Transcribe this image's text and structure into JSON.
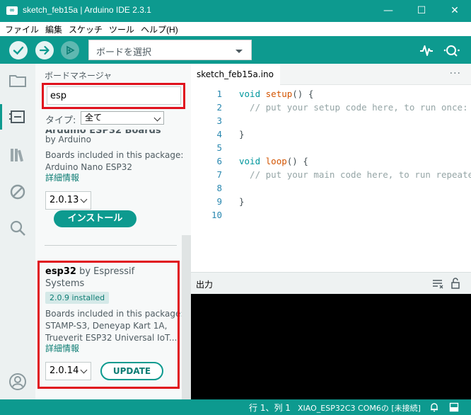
{
  "window": {
    "title": "sketch_feb15a | Arduino IDE 2.3.1",
    "app_icon": "∞",
    "minimize": "—",
    "maximize": "☐",
    "close": "✕"
  },
  "menu": [
    "ファイル",
    "編集",
    "スケッチ",
    "ツール",
    "ヘルプ(H)"
  ],
  "toolbar": {
    "board_select": "ボードを選択",
    "icons": [
      "verify-icon",
      "upload-icon",
      "debug-icon",
      "serial-plotter-icon",
      "serial-monitor-icon"
    ]
  },
  "sidebar": {
    "title": "ボードマネージャ",
    "search_value": "esp",
    "type_label": "タイプ:",
    "type_value": "全て",
    "card1": {
      "name": "Arduino ESP32 Boards",
      "by": "by Arduino",
      "desc1": "Boards included in this package:",
      "desc2": "Arduino Nano ESP32",
      "more": "詳細情報",
      "version": "2.0.13",
      "install": "インストール"
    },
    "card2": {
      "name": "esp32",
      "by": " by Espressif",
      "by2": "Systems",
      "installed": "2.0.9 installed",
      "desc1": "Boards included in this package:",
      "desc2": "STAMP-S3, Deneyap Kart 1A,",
      "desc3": "Trueverit ESP32 Universal IoT...",
      "more": "詳細情報",
      "version": "2.0.14",
      "update": "UPDATE"
    }
  },
  "editor": {
    "tab": "sketch_feb15a.ino",
    "more": "···",
    "line_numbers": [
      "1",
      "2",
      "3",
      "4",
      "5",
      "6",
      "7",
      "8",
      "9",
      "10"
    ],
    "code": {
      "l1_kw": "void",
      "l1_fn": "setup",
      "l1_rest": "() {",
      "l2": "  // put your setup code here, to run once:",
      "l4": "}",
      "l6_kw": "void",
      "l6_fn": "loop",
      "l6_rest": "() {",
      "l7": "  // put your main code here, to run repeatedly:",
      "l9": "}"
    }
  },
  "output": {
    "label": "出力"
  },
  "status": {
    "position": "行 1、列 1",
    "board": "XIAO_ESP32C3 COM6の [未接続]"
  },
  "colors": {
    "accent": "#0d9a8f",
    "highlight": "#e0111d"
  }
}
